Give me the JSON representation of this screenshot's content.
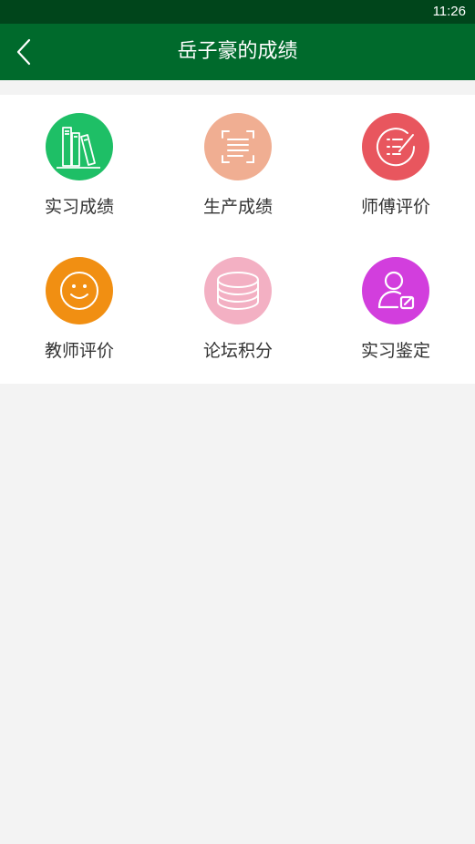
{
  "status_bar": {
    "time": "11:26"
  },
  "app_bar": {
    "title": "岳子豪的成绩",
    "back_icon": "chevron-left-icon"
  },
  "colors": {
    "status_bar": "#00451b",
    "app_bar": "#006a2c",
    "background": "#f3f3f3"
  },
  "menu": [
    {
      "label": "实习成绩",
      "icon": "books-icon",
      "color": "#1ebf66"
    },
    {
      "label": "生产成绩",
      "icon": "document-scan-icon",
      "color": "#f0ae92"
    },
    {
      "label": "师傅评价",
      "icon": "checklist-icon",
      "color": "#e8565e"
    },
    {
      "label": "教师评价",
      "icon": "smiley-icon",
      "color": "#f18f12"
    },
    {
      "label": "论坛积分",
      "icon": "coins-stack-icon",
      "color": "#f3b0c3"
    },
    {
      "label": "实习鉴定",
      "icon": "user-edit-icon",
      "color": "#d23edd"
    }
  ]
}
